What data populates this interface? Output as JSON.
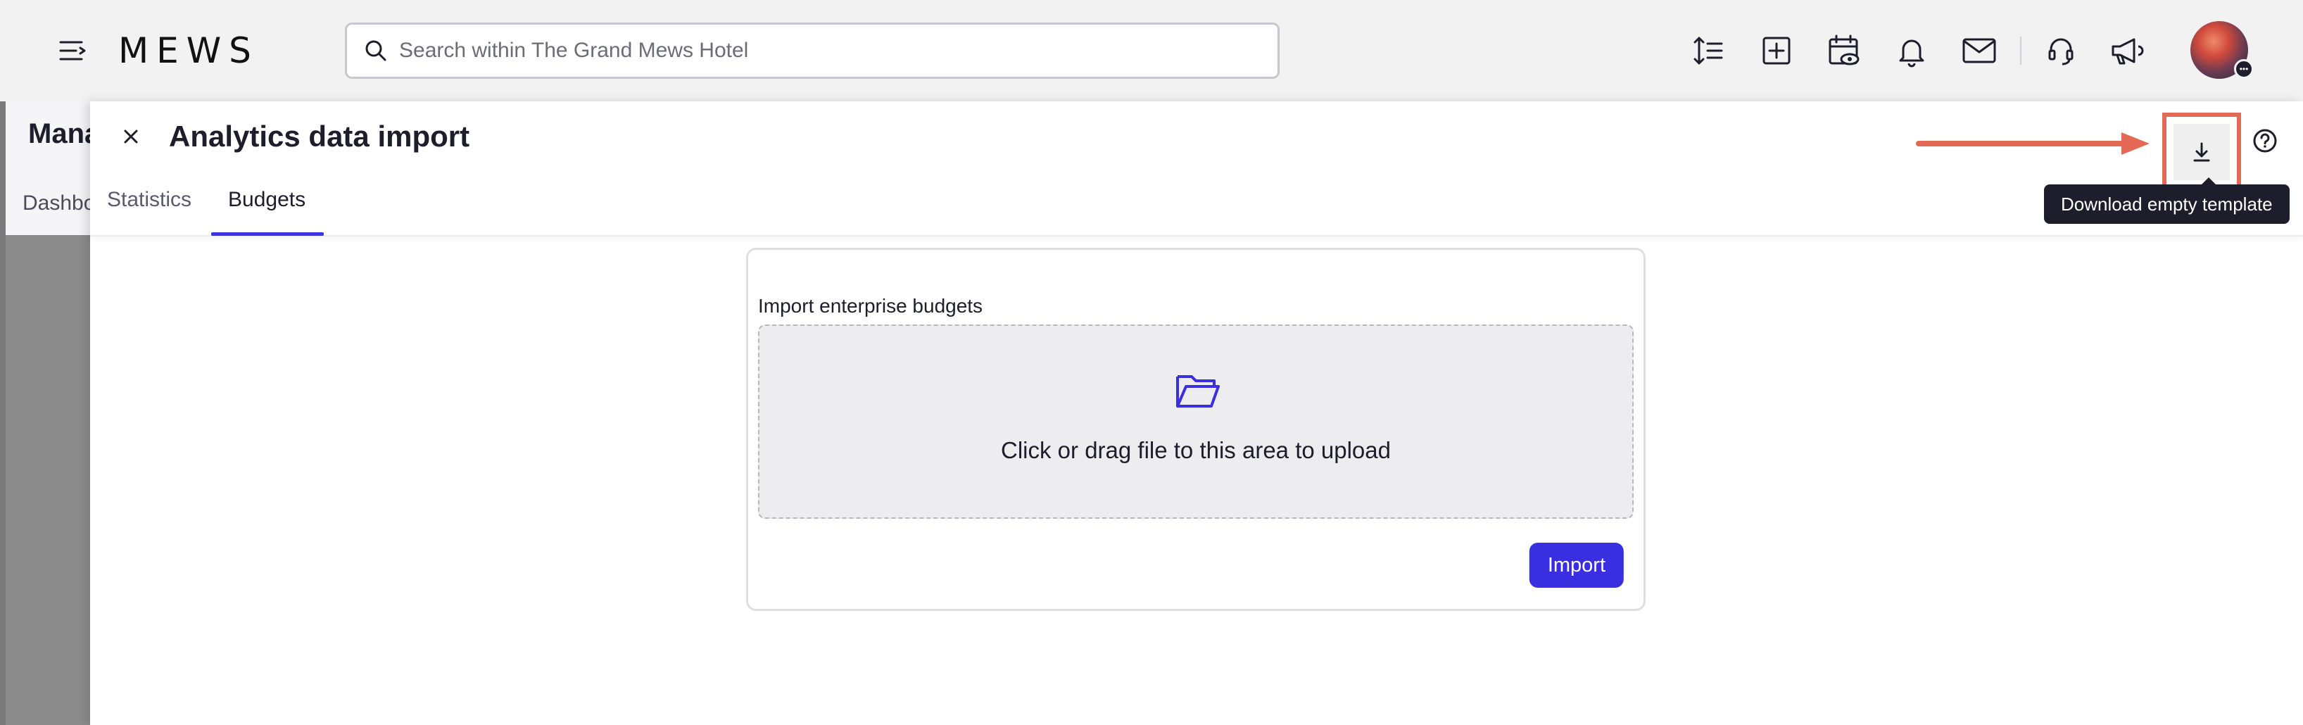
{
  "topbar": {
    "logo": "MEWS",
    "search": {
      "placeholder": "Search within The Grand Mews Hotel",
      "value": ""
    },
    "icons": [
      "menu-icon",
      "sort-lines-icon",
      "plus-square-icon",
      "calendar-eye-icon",
      "bell-icon",
      "mail-icon",
      "headset-icon",
      "megaphone-icon"
    ]
  },
  "background_page": {
    "title": "Mana",
    "tab": "Dashbo"
  },
  "drawer": {
    "title": "Analytics data import",
    "tabs": [
      {
        "label": "Statistics",
        "active": false
      },
      {
        "label": "Budgets",
        "active": true
      }
    ],
    "tooltip": "Download empty template",
    "card": {
      "label": "Import enterprise budgets",
      "dropzone_text": "Click or drag file to this area to upload",
      "import_button": "Import"
    }
  },
  "colors": {
    "accent": "#3a2fe0",
    "highlight": "#e46a55",
    "topbar_bg": "#f2f2f2",
    "tooltip_bg": "#1d1d2b"
  }
}
